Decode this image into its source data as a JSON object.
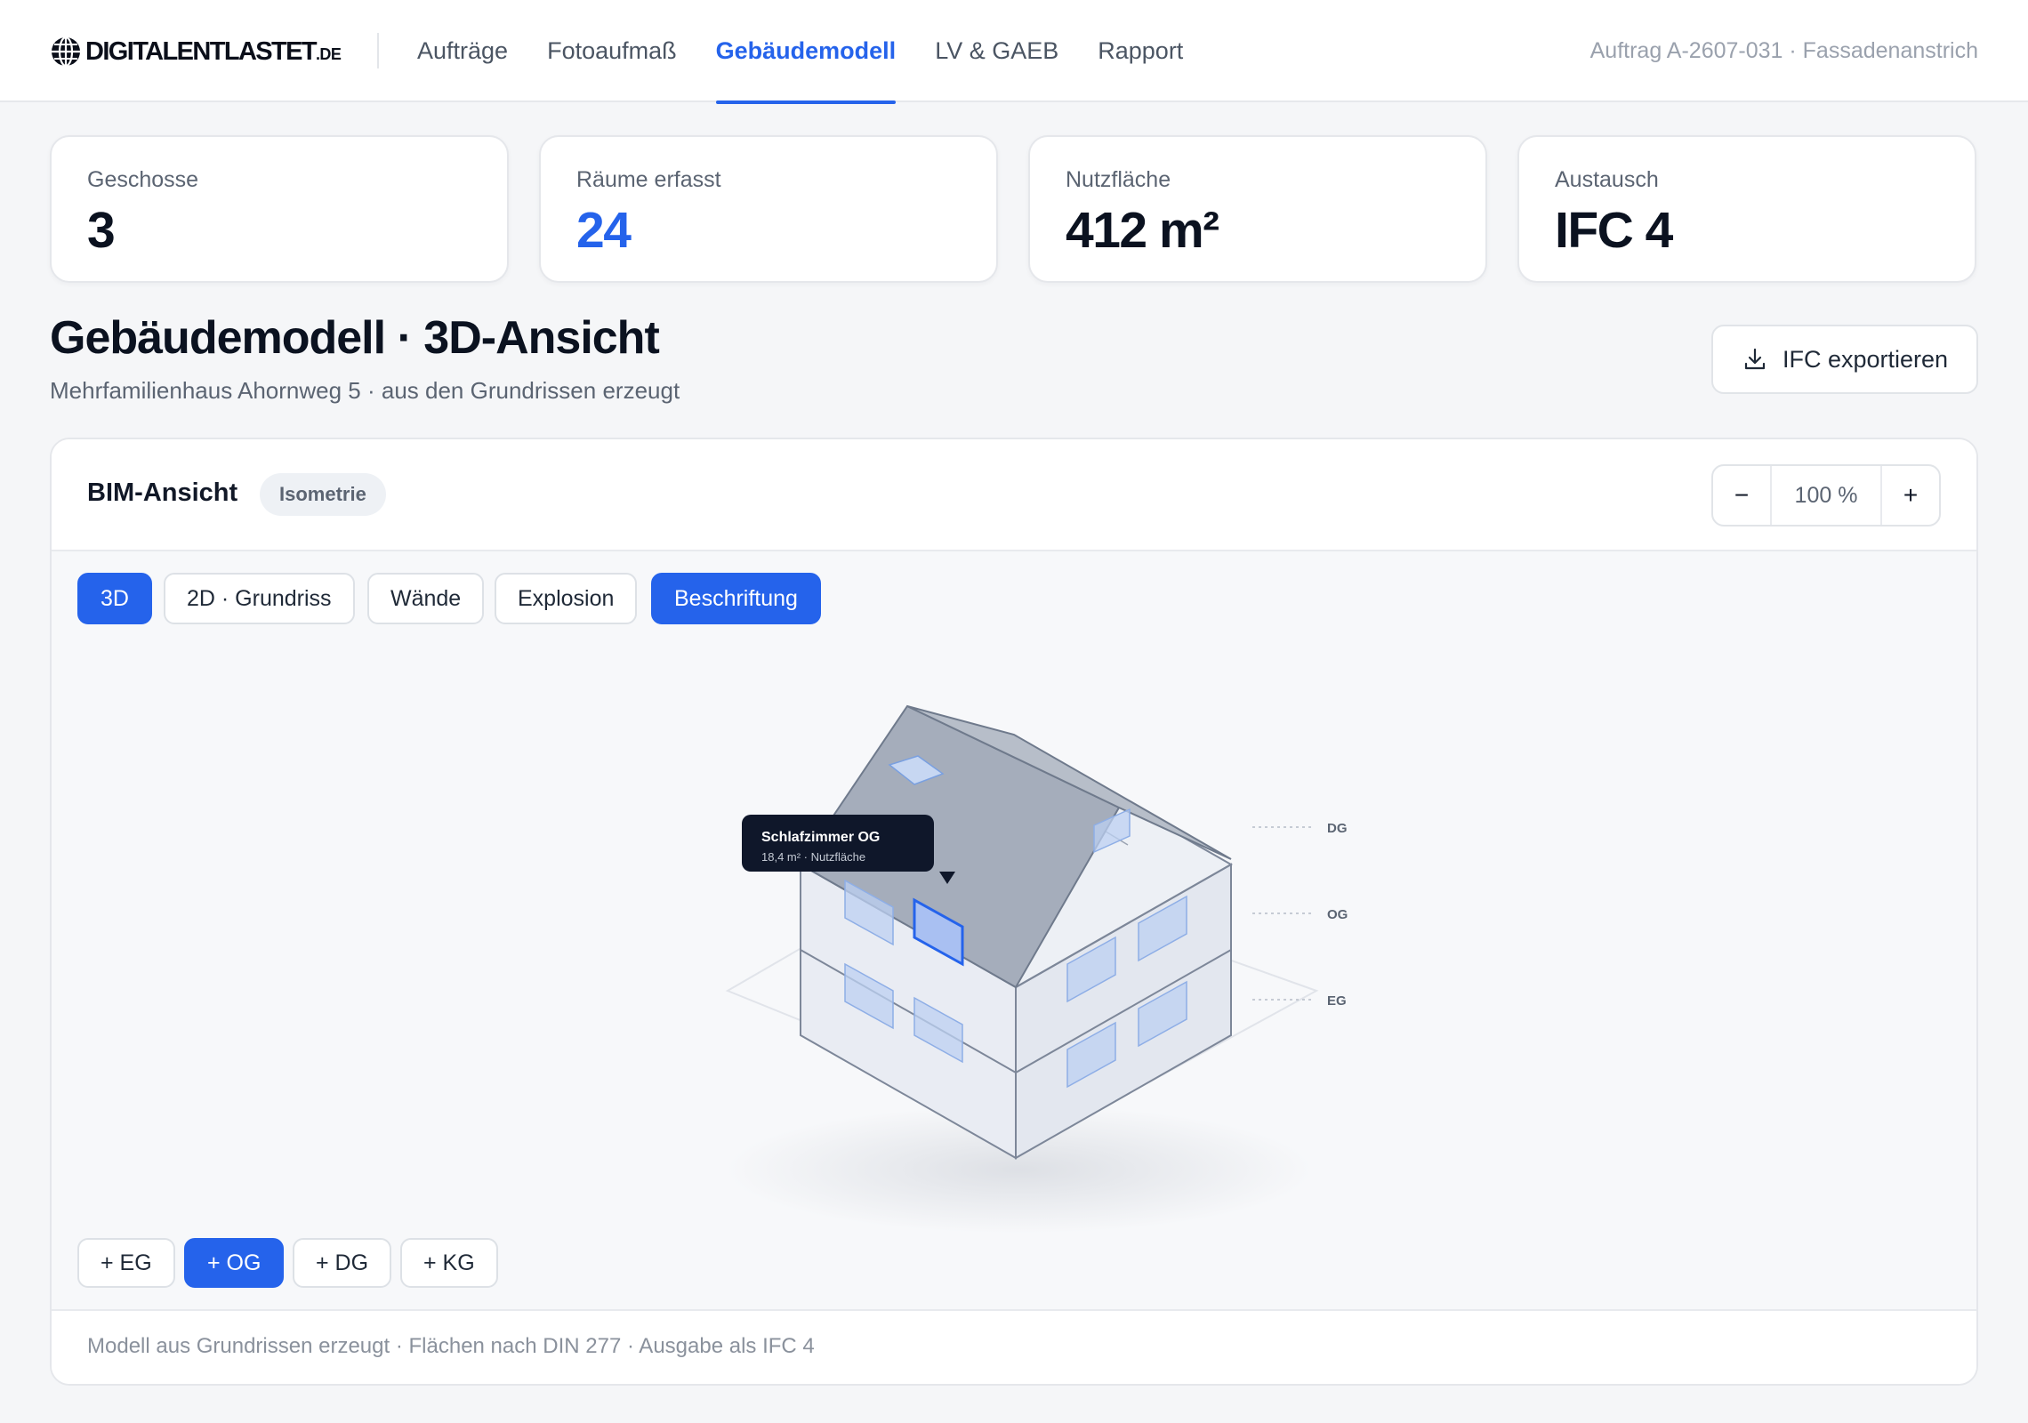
{
  "brand": {
    "name": "DIGITALENTLASTET",
    "tld": ".DE"
  },
  "nav": [
    {
      "label": "Aufträge"
    },
    {
      "label": "Fotoaufmaß"
    },
    {
      "label": "Gebäudemodell"
    },
    {
      "label": "LV & GAEB"
    },
    {
      "label": "Rapport"
    }
  ],
  "job": "Auftrag A-2607-031 · Fassadenanstrich",
  "stats": [
    {
      "label": "Geschosse",
      "value": "3"
    },
    {
      "label": "Räume erfasst",
      "value": "24"
    },
    {
      "label": "Nutzfläche",
      "value": "412 m²"
    },
    {
      "label": "Austausch",
      "value": "IFC 4"
    }
  ],
  "page": {
    "title": "Gebäudemodell · 3D-Ansicht",
    "subtitle": "Mehrfamilienhaus Ahornweg 5 · aus den Grundrissen erzeugt",
    "export_label": "IFC exportieren"
  },
  "viewer": {
    "title": "BIM-Ansicht",
    "badge": "Isometrie",
    "zoom": {
      "minus": "−",
      "value": "100 %",
      "plus": "+"
    },
    "tools": [
      {
        "label": "3D",
        "active": true
      },
      {
        "label": "2D · Grundriss",
        "active": false
      },
      {
        "label": "Wände",
        "active": false
      },
      {
        "label": "Explosion",
        "active": false
      },
      {
        "label": "Beschriftung",
        "active": true
      }
    ],
    "floors": [
      {
        "label": "+ EG",
        "active": false
      },
      {
        "label": "+ OG",
        "active": true
      },
      {
        "label": "+ DG",
        "active": false
      },
      {
        "label": "+ KG",
        "active": false
      }
    ],
    "levels": {
      "dg": "DG",
      "og": "OG",
      "eg": "EG"
    },
    "tooltip": {
      "title": "Schlafzimmer OG",
      "detail": "18,4 m² · Nutzfläche"
    },
    "footer": "Modell aus Grundrissen erzeugt · Flächen nach DIN 277 · Ausgabe als IFC 4"
  },
  "colors": {
    "accent": "#2563eb",
    "text": "#111827",
    "muted": "#5b6472"
  }
}
